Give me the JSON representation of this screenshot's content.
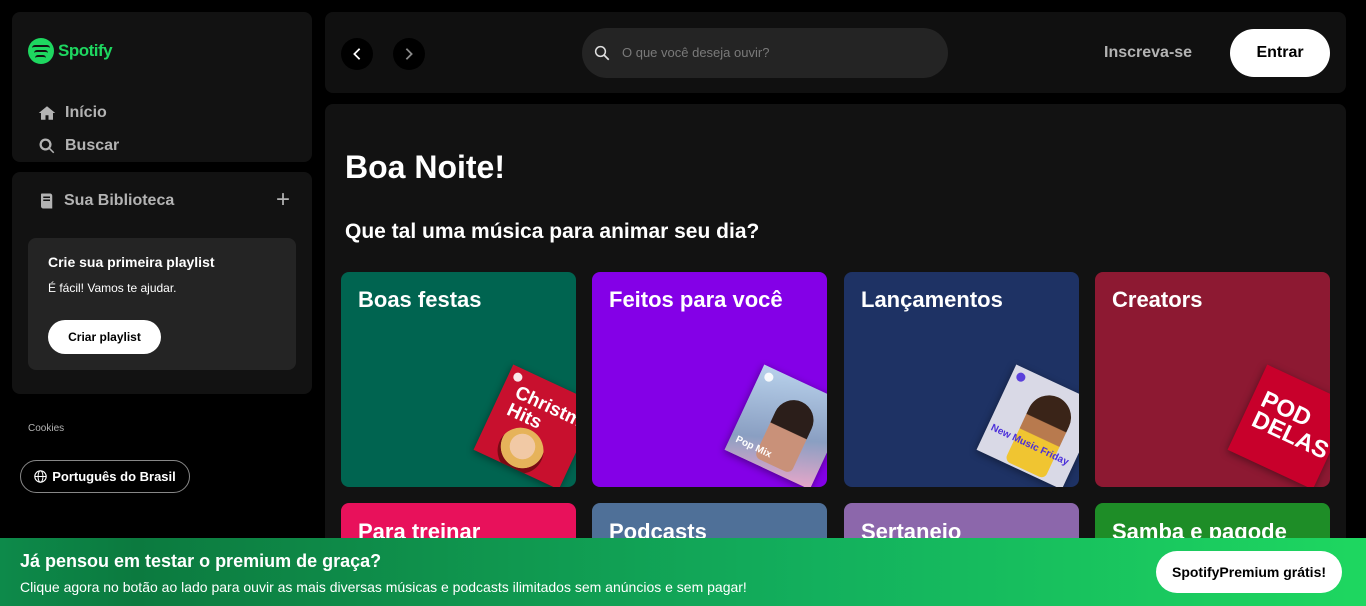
{
  "brand": {
    "name": "Spotify",
    "color": "#1ed760"
  },
  "nav": {
    "home_label": "Início",
    "home_icon": "home-icon",
    "search_label": "Buscar",
    "search_icon": "search-icon"
  },
  "library": {
    "title": "Sua Biblioteca",
    "add_glyph": "+",
    "card": {
      "title": "Crie sua primeira playlist",
      "subtitle": "É fácil! Vamos te ajudar.",
      "button": "Criar playlist"
    }
  },
  "footer": {
    "cookies": "Cookies",
    "language": "Português do Brasil"
  },
  "topbar": {
    "search_placeholder": "O que você deseja ouvir?",
    "signup": "Inscreva-se",
    "login": "Entrar"
  },
  "main": {
    "greeting": "Boa Noite!",
    "subtitle": "Que tal uma música para animar seu dia?",
    "cards": [
      {
        "label": "Boas festas",
        "color": "#006450",
        "art_text": "Christmas Hits",
        "art_color": "#c8102e"
      },
      {
        "label": "Feitos para você",
        "color": "#8400e7",
        "art_text": "Pop Mix",
        "art_color": "#9bb8d8"
      },
      {
        "label": "Lançamentos",
        "color": "#1e3264",
        "art_text": "New Music Friday",
        "art_color": "#d9d9e6"
      },
      {
        "label": "Creators",
        "color": "#8d1932",
        "art_text": "POD DELAS",
        "art_color": "#c8002b"
      },
      {
        "label": "Para treinar",
        "color": "#e8115b"
      },
      {
        "label": "Podcasts",
        "color": "#4f7098"
      },
      {
        "label": "Sertanejo",
        "color": "#8c67ab"
      },
      {
        "label": "Samba e pagode",
        "color": "#1e8d27"
      }
    ]
  },
  "banner": {
    "title": "Já pensou em testar o premium de graça?",
    "subtitle": "Clique agora no botão ao lado para ouvir as mais diversas músicas e podcasts ilimitados sem anúncios e sem pagar!",
    "button": "SpotifyPremium grátis!"
  }
}
